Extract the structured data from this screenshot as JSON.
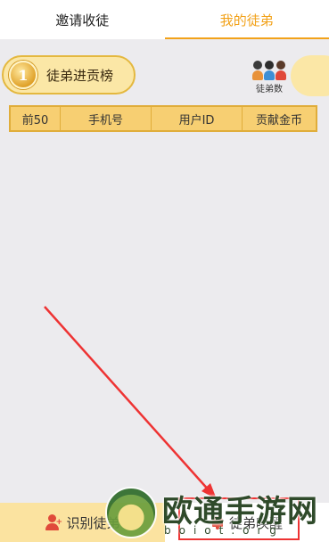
{
  "tabs": [
    {
      "label": "邀请收徒",
      "active": false
    },
    {
      "label": "我的徒弟",
      "active": true
    }
  ],
  "rank_badge": {
    "number": "1",
    "title": "徒弟进贡榜"
  },
  "count_icon": {
    "label": "徒弟数"
  },
  "table": {
    "headers": [
      "前50",
      "手机号",
      "用户ID",
      "贡献金币"
    ]
  },
  "bottom_bar": {
    "identify_label": "识别徒弟",
    "wake_label": "徒弟唤醒"
  },
  "watermark": {
    "text": "欧通手游网",
    "sub": "boiot.org"
  },
  "colors": {
    "accent": "#f2a21a",
    "badge_bg": "#fbe7a6",
    "table_header_bg": "#f7cf72",
    "annotation_red": "#e33"
  }
}
